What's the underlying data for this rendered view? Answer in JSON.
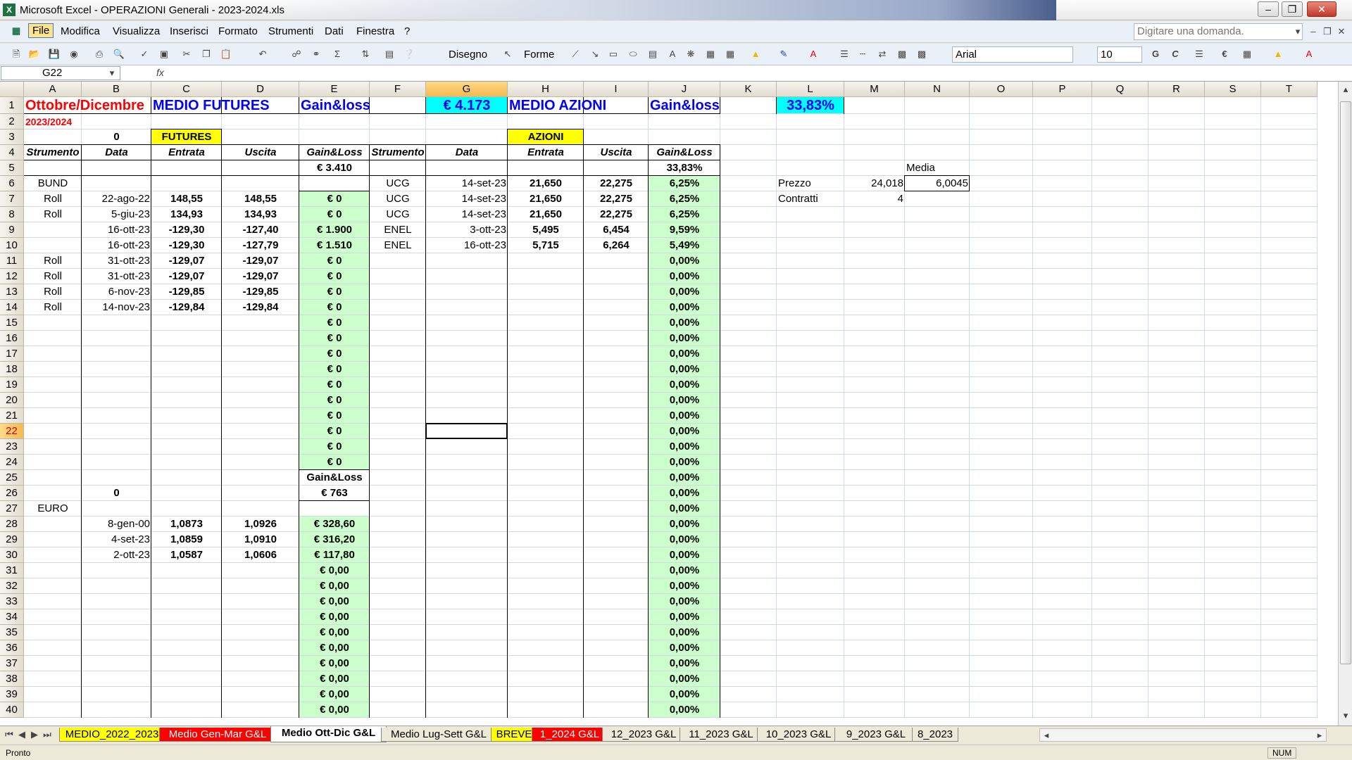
{
  "window": {
    "title": "Microsoft Excel - OPERAZIONI Generali - 2023-2024.xls"
  },
  "menu": [
    "File",
    "Modifica",
    "Visualizza",
    "Inserisci",
    "Formato",
    "Strumenti",
    "Dati",
    "Finestra",
    "?"
  ],
  "ask_placeholder": "Digitare una domanda.",
  "toolbar": {
    "draw_label": "Disegno",
    "shapes_label": "Forme",
    "font": "Arial",
    "font_size": "10",
    "bold": "G",
    "italic": "C",
    "currency": "€"
  },
  "namebox": "G22",
  "fx": "fx",
  "columns": [
    "A",
    "B",
    "C",
    "D",
    "E",
    "F",
    "G",
    "H",
    "I",
    "J",
    "K",
    "L",
    "M",
    "N",
    "O",
    "P",
    "Q",
    "R",
    "S",
    "T"
  ],
  "rows": [
    "1",
    "2",
    "3",
    "4",
    "5",
    "6",
    "7",
    "8",
    "9",
    "10",
    "11",
    "12",
    "13",
    "14",
    "15",
    "16",
    "17",
    "18",
    "19",
    "20",
    "21",
    "22",
    "23",
    "24",
    "25",
    "26",
    "27",
    "28",
    "29",
    "30",
    "31",
    "32",
    "33",
    "34",
    "35",
    "36",
    "37",
    "38",
    "39",
    "40"
  ],
  "cells": [
    {
      "c": "A",
      "r": 1,
      "v": "Ottobre/Dicembre",
      "s": "red-big"
    },
    {
      "c": "C",
      "r": 1,
      "v": "MEDIO FUTURES",
      "s": "blue-big"
    },
    {
      "c": "E",
      "r": 1,
      "v": "Gain&loss",
      "s": "blue-big"
    },
    {
      "c": "G",
      "r": 1,
      "v": "€ 4.173",
      "s": "cyan-big"
    },
    {
      "c": "H",
      "r": 1,
      "v": "MEDIO AZIONI",
      "s": "blue-big"
    },
    {
      "c": "J",
      "r": 1,
      "v": "Gain&loss",
      "s": "blue-big"
    },
    {
      "c": "L",
      "r": 1,
      "v": "33,83%",
      "s": "cyan-big"
    },
    {
      "c": "A",
      "r": 2,
      "v": "2023/2024",
      "s": "red"
    },
    {
      "c": "B",
      "r": 3,
      "v": "0",
      "s": "bold-center"
    },
    {
      "c": "C",
      "r": 3,
      "v": "FUTURES",
      "s": "yellow"
    },
    {
      "c": "H",
      "r": 3,
      "v": "AZIONI",
      "s": "yellow"
    },
    {
      "c": "A",
      "r": 4,
      "v": "Strumento",
      "s": "hdr"
    },
    {
      "c": "B",
      "r": 4,
      "v": "Data",
      "s": "hdr"
    },
    {
      "c": "C",
      "r": 4,
      "v": "Entrata",
      "s": "hdr"
    },
    {
      "c": "D",
      "r": 4,
      "v": "Uscita",
      "s": "hdr"
    },
    {
      "c": "E",
      "r": 4,
      "v": "Gain&Loss",
      "s": "hdr"
    },
    {
      "c": "F",
      "r": 4,
      "v": "Strumento",
      "s": "hdr"
    },
    {
      "c": "G",
      "r": 4,
      "v": "Data",
      "s": "hdr"
    },
    {
      "c": "H",
      "r": 4,
      "v": "Entrata",
      "s": "hdr"
    },
    {
      "c": "I",
      "r": 4,
      "v": "Uscita",
      "s": "hdr"
    },
    {
      "c": "J",
      "r": 4,
      "v": "Gain&Loss",
      "s": "hdr"
    },
    {
      "c": "E",
      "r": 5,
      "v": "€ 3.410",
      "s": "bold-center"
    },
    {
      "c": "J",
      "r": 5,
      "v": "33,83%",
      "s": "bold-center"
    },
    {
      "c": "N",
      "r": 5,
      "v": "Media",
      "s": "plain-left"
    },
    {
      "c": "A",
      "r": 6,
      "v": "BUND",
      "s": "center"
    },
    {
      "c": "F",
      "r": 6,
      "v": "UCG",
      "s": "center"
    },
    {
      "c": "G",
      "r": 6,
      "v": "14-set-23",
      "s": "right"
    },
    {
      "c": "H",
      "r": 6,
      "v": "21,650",
      "s": "bold-center"
    },
    {
      "c": "I",
      "r": 6,
      "v": "22,275",
      "s": "bold-center"
    },
    {
      "c": "L",
      "r": 6,
      "v": "Prezzo",
      "s": "plain-left"
    },
    {
      "c": "M",
      "r": 6,
      "v": "24,018",
      "s": "right"
    },
    {
      "c": "N",
      "r": 6,
      "v": "6,0045",
      "s": "right"
    },
    {
      "c": "A",
      "r": 7,
      "v": "Roll",
      "s": "center"
    },
    {
      "c": "B",
      "r": 7,
      "v": "22-ago-22",
      "s": "right"
    },
    {
      "c": "C",
      "r": 7,
      "v": "148,55",
      "s": "bold-center"
    },
    {
      "c": "D",
      "r": 7,
      "v": "148,55",
      "s": "bold-center"
    },
    {
      "c": "F",
      "r": 7,
      "v": "UCG",
      "s": "center"
    },
    {
      "c": "G",
      "r": 7,
      "v": "14-set-23",
      "s": "right"
    },
    {
      "c": "H",
      "r": 7,
      "v": "21,650",
      "s": "bold-center"
    },
    {
      "c": "I",
      "r": 7,
      "v": "22,275",
      "s": "bold-center"
    },
    {
      "c": "L",
      "r": 7,
      "v": "Contratti",
      "s": "plain-left"
    },
    {
      "c": "M",
      "r": 7,
      "v": "4",
      "s": "right"
    },
    {
      "c": "A",
      "r": 8,
      "v": "Roll",
      "s": "center"
    },
    {
      "c": "B",
      "r": 8,
      "v": "5-giu-23",
      "s": "right"
    },
    {
      "c": "C",
      "r": 8,
      "v": "134,93",
      "s": "bold-center"
    },
    {
      "c": "D",
      "r": 8,
      "v": "134,93",
      "s": "bold-center"
    },
    {
      "c": "F",
      "r": 8,
      "v": "UCG",
      "s": "center"
    },
    {
      "c": "G",
      "r": 8,
      "v": "14-set-23",
      "s": "right"
    },
    {
      "c": "H",
      "r": 8,
      "v": "21,650",
      "s": "bold-center"
    },
    {
      "c": "I",
      "r": 8,
      "v": "22,275",
      "s": "bold-center"
    },
    {
      "c": "B",
      "r": 9,
      "v": "16-ott-23",
      "s": "right"
    },
    {
      "c": "C",
      "r": 9,
      "v": "-129,30",
      "s": "bold-center"
    },
    {
      "c": "D",
      "r": 9,
      "v": "-127,40",
      "s": "bold-center"
    },
    {
      "c": "F",
      "r": 9,
      "v": "ENEL",
      "s": "center"
    },
    {
      "c": "G",
      "r": 9,
      "v": "3-ott-23",
      "s": "right"
    },
    {
      "c": "H",
      "r": 9,
      "v": "5,495",
      "s": "bold-center"
    },
    {
      "c": "I",
      "r": 9,
      "v": "6,454",
      "s": "bold-center"
    },
    {
      "c": "B",
      "r": 10,
      "v": "16-ott-23",
      "s": "right"
    },
    {
      "c": "C",
      "r": 10,
      "v": "-129,30",
      "s": "bold-center"
    },
    {
      "c": "D",
      "r": 10,
      "v": "-127,79",
      "s": "bold-center"
    },
    {
      "c": "F",
      "r": 10,
      "v": "ENEL",
      "s": "center"
    },
    {
      "c": "G",
      "r": 10,
      "v": "16-ott-23",
      "s": "right"
    },
    {
      "c": "H",
      "r": 10,
      "v": "5,715",
      "s": "bold-center"
    },
    {
      "c": "I",
      "r": 10,
      "v": "6,264",
      "s": "bold-center"
    },
    {
      "c": "A",
      "r": 11,
      "v": "Roll",
      "s": "center"
    },
    {
      "c": "B",
      "r": 11,
      "v": "31-ott-23",
      "s": "right"
    },
    {
      "c": "C",
      "r": 11,
      "v": "-129,07",
      "s": "bold-center"
    },
    {
      "c": "D",
      "r": 11,
      "v": "-129,07",
      "s": "bold-center"
    },
    {
      "c": "A",
      "r": 12,
      "v": "Roll",
      "s": "center"
    },
    {
      "c": "B",
      "r": 12,
      "v": "31-ott-23",
      "s": "right"
    },
    {
      "c": "C",
      "r": 12,
      "v": "-129,07",
      "s": "bold-center"
    },
    {
      "c": "D",
      "r": 12,
      "v": "-129,07",
      "s": "bold-center"
    },
    {
      "c": "A",
      "r": 13,
      "v": "Roll",
      "s": "center"
    },
    {
      "c": "B",
      "r": 13,
      "v": "6-nov-23",
      "s": "right"
    },
    {
      "c": "C",
      "r": 13,
      "v": "-129,85",
      "s": "bold-center"
    },
    {
      "c": "D",
      "r": 13,
      "v": "-129,85",
      "s": "bold-center"
    },
    {
      "c": "A",
      "r": 14,
      "v": "Roll",
      "s": "center"
    },
    {
      "c": "B",
      "r": 14,
      "v": "14-nov-23",
      "s": "right"
    },
    {
      "c": "C",
      "r": 14,
      "v": "-129,84",
      "s": "bold-center"
    },
    {
      "c": "D",
      "r": 14,
      "v": "-129,84",
      "s": "bold-center"
    },
    {
      "c": "E",
      "r": 25,
      "v": "Gain&Loss",
      "s": "bold-center"
    },
    {
      "c": "B",
      "r": 26,
      "v": "0",
      "s": "bold-center"
    },
    {
      "c": "E",
      "r": 26,
      "v": "€ 763",
      "s": "bold-center"
    },
    {
      "c": "A",
      "r": 27,
      "v": "EURO",
      "s": "center"
    },
    {
      "c": "B",
      "r": 28,
      "v": "8-gen-00",
      "s": "right"
    },
    {
      "c": "C",
      "r": 28,
      "v": "1,0873",
      "s": "bold-center"
    },
    {
      "c": "D",
      "r": 28,
      "v": "1,0926",
      "s": "bold-center"
    },
    {
      "c": "B",
      "r": 29,
      "v": "4-set-23",
      "s": "right"
    },
    {
      "c": "C",
      "r": 29,
      "v": "1,0859",
      "s": "bold-center"
    },
    {
      "c": "D",
      "r": 29,
      "v": "1,0910",
      "s": "bold-center"
    },
    {
      "c": "B",
      "r": 30,
      "v": "2-ott-23",
      "s": "right"
    },
    {
      "c": "C",
      "r": 30,
      "v": "1,0587",
      "s": "bold-center"
    },
    {
      "c": "D",
      "r": 30,
      "v": "1,0606",
      "s": "bold-center"
    }
  ],
  "gain_futures": [
    "€ 0",
    "€ 0",
    "€ 1.900",
    "€ 1.510",
    "€ 0",
    "€ 0",
    "€ 0",
    "€ 0",
    "€ 0",
    "€ 0",
    "€ 0",
    "€ 0",
    "€ 0",
    "€ 0",
    "€ 0",
    "€ 0",
    "€ 0",
    "€ 0"
  ],
  "gain_euro": [
    "€ 328,60",
    "€ 316,20",
    "€ 117,80",
    "€ 0,00",
    "€ 0,00",
    "€ 0,00",
    "€ 0,00",
    "€ 0,00",
    "€ 0,00",
    "€ 0,00",
    "€ 0,00",
    "€ 0,00",
    "€ 0,00"
  ],
  "gain_azioni": [
    "6,25%",
    "6,25%",
    "6,25%",
    "9,59%",
    "5,49%",
    "0,00%",
    "0,00%",
    "0,00%",
    "0,00%",
    "0,00%",
    "0,00%",
    "0,00%",
    "0,00%",
    "0,00%",
    "0,00%",
    "0,00%",
    "0,00%",
    "0,00%",
    "0,00%",
    "0,00%",
    "0,00%",
    "0,00%",
    "0,00%",
    "0,00%",
    "0,00%",
    "0,00%",
    "0,00%",
    "0,00%",
    "0,00%",
    "0,00%",
    "0,00%",
    "0,00%",
    "0,00%",
    "0,00%",
    "0,00%"
  ],
  "tabs": [
    {
      "label": "MEDIO_2022_2023",
      "color": "#ffff00"
    },
    {
      "label": "Medio Gen-Mar G&L",
      "color": "#ff0000"
    },
    {
      "label": "Medio Ott-Dic G&L",
      "color": "#ffffff"
    },
    {
      "label": "Medio Lug-Sett G&L",
      "color": "#ece9d8"
    },
    {
      "label": "BREVE",
      "color": "#ffff00"
    },
    {
      "label": "1_2024 G&L",
      "color": "#ff0000"
    },
    {
      "label": "12_2023 G&L",
      "color": "#ece9d8"
    },
    {
      "label": "11_2023 G&L",
      "color": "#ece9d8"
    },
    {
      "label": "10_2023 G&L",
      "color": "#ece9d8"
    },
    {
      "label": "9_2023 G&L",
      "color": "#ece9d8"
    },
    {
      "label": "8_2023",
      "color": "#ece9d8"
    }
  ],
  "status": {
    "left": "Pronto",
    "num": "NUM"
  },
  "colors": {
    "green_fill": "#ccffcc",
    "cyan_fill": "#00ffff",
    "yellow_fill": "#ffff00",
    "red_text": "#ff0000",
    "blue_text": "#0000ff",
    "selection_header": "#f5b94f"
  }
}
